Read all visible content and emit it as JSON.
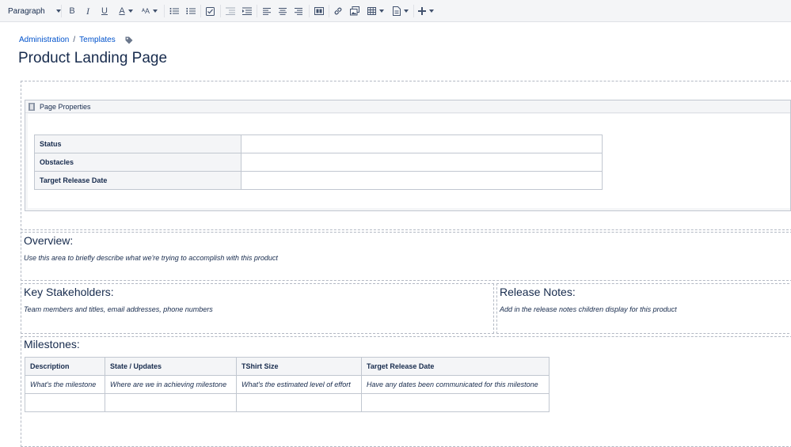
{
  "toolbar": {
    "style_select": "Paragraph",
    "buttons": [
      "bold",
      "italic",
      "underline",
      "text-color",
      "text-size",
      "bullet-list",
      "numbered-list",
      "task-list",
      "outdent",
      "indent",
      "align-left",
      "align-center",
      "align-right",
      "page-layout",
      "link",
      "image",
      "table",
      "template",
      "insert-more"
    ]
  },
  "breadcrumb": [
    "Administration",
    "Templates"
  ],
  "page_title": "Product Landing Page",
  "page_properties": {
    "macro_title": "Page Properties",
    "rows": [
      "Status",
      "Obstacles",
      "Target Release Date"
    ]
  },
  "overview": {
    "heading": "Overview:",
    "text": "Use this area to briefly describe what we're trying to accomplish with this product"
  },
  "key_stakeholders": {
    "heading": "Key Stakeholders:",
    "text": "Team members and titles, email addresses, phone numbers"
  },
  "release_notes": {
    "heading": "Release Notes:",
    "text": "Add in the release notes children display for this product"
  },
  "milestones": {
    "heading": "Milestones:",
    "headers": [
      "Description",
      "State / Updates",
      "TShirt Size",
      "Target Release Date"
    ],
    "rows": [
      [
        "What's the milestone",
        "Where are we in achieving milestone",
        "What's the estimated level of effort",
        "Have any dates been communicated for this milestone"
      ],
      [
        "",
        "",
        "",
        ""
      ]
    ]
  },
  "colors": {
    "link": "#0052cc",
    "text": "#172b4d",
    "toolbar_bg": "#f4f5f7",
    "table_header_bg": "#f4f5f7",
    "border": "#c1c7d0"
  }
}
